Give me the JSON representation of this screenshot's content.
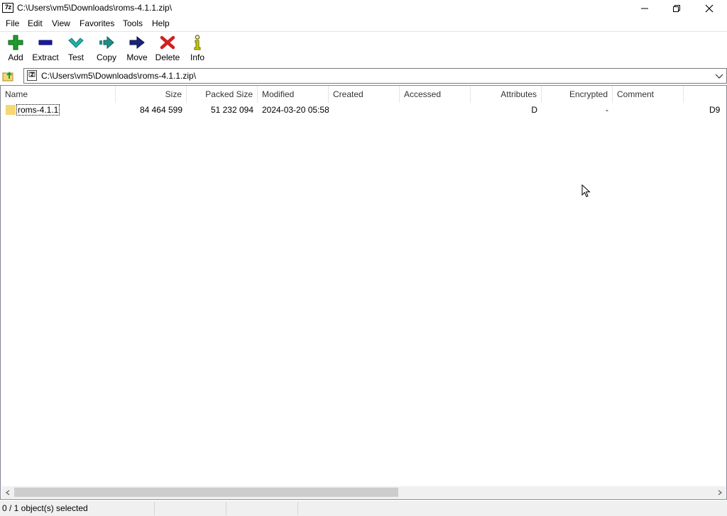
{
  "window": {
    "title": "C:\\Users\\vm5\\Downloads\\roms-4.1.1.zip\\",
    "app_icon_text": "7z"
  },
  "menu": [
    "File",
    "Edit",
    "View",
    "Favorites",
    "Tools",
    "Help"
  ],
  "toolbar": {
    "add": "Add",
    "extract": "Extract",
    "test": "Test",
    "copy": "Copy",
    "move": "Move",
    "delete": "Delete",
    "info": "Info"
  },
  "address": {
    "path": "C:\\Users\\vm5\\Downloads\\roms-4.1.1.zip\\"
  },
  "columns": {
    "name": "Name",
    "size": "Size",
    "packed_size": "Packed Size",
    "modified": "Modified",
    "created": "Created",
    "accessed": "Accessed",
    "attributes": "Attributes",
    "encrypted": "Encrypted",
    "comment": "Comment"
  },
  "rows": [
    {
      "name": "roms-4.1.1",
      "size": "84 464 599",
      "packed_size": "51 232 094",
      "modified": "2024-03-20 05:58",
      "created": "",
      "accessed": "",
      "attributes": "D",
      "encrypted": "-",
      "comment": "",
      "crc_partial": "D9"
    }
  ],
  "status": {
    "selection": "0 / 1 object(s) selected"
  },
  "colors": {
    "add_green": "#1e9e2e",
    "extract_blue": "#1a1aa6",
    "test_teal": "#20b2aa",
    "copy_teal": "#1f8f85",
    "move_navy": "#1a237e",
    "delete_red": "#d21f1f",
    "info_olive": "#8a8a00",
    "folder_yellow": "#f5d774"
  }
}
